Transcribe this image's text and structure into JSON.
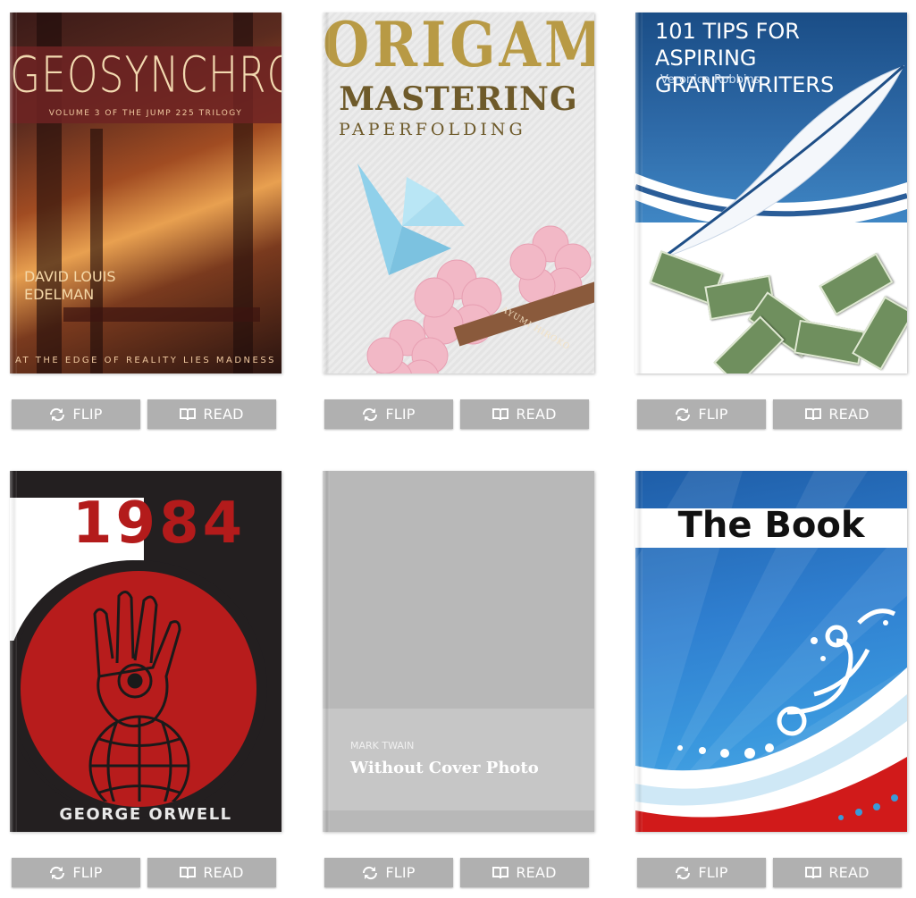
{
  "colors": {
    "button_bg": "#b0b0b0",
    "button_text": "#ffffff"
  },
  "books": [
    {
      "id": "geosynchron",
      "cover": {
        "title": "GEOSYNCHRON",
        "subtitle": "VOLUME 3 OF THE JUMP 225 TRILOGY",
        "author_line1": "DAVID LOUIS",
        "author_line2": "EDELMAN",
        "tagline": "AT THE EDGE OF REALITY LIES MADNESS"
      },
      "flip_label": "FLIP",
      "read_label": "READ"
    },
    {
      "id": "origami",
      "cover": {
        "title_top": "ORIGAMI",
        "title_main": "MASTERING",
        "title_sub": "PAPERFOLDING",
        "author": "AYUMI HIROKO"
      },
      "flip_label": "FLIP",
      "read_label": "READ"
    },
    {
      "id": "grant-writers",
      "cover": {
        "title_line1": "101 TIPS FOR ASPIRING",
        "title_line2": "GRANT WRITERS",
        "author": "Veronica Robbins"
      },
      "flip_label": "FLIP",
      "read_label": "READ"
    },
    {
      "id": "1984",
      "cover": {
        "title": "1984",
        "author": "GEORGE ORWELL"
      },
      "flip_label": "FLIP",
      "read_label": "READ"
    },
    {
      "id": "without-cover",
      "cover": {
        "author": "MARK TWAIN",
        "title": "Without Cover Photo"
      },
      "flip_label": "FLIP",
      "read_label": "READ"
    },
    {
      "id": "the-book",
      "cover": {
        "title": "The Book"
      },
      "flip_label": "FLIP",
      "read_label": "READ"
    }
  ]
}
